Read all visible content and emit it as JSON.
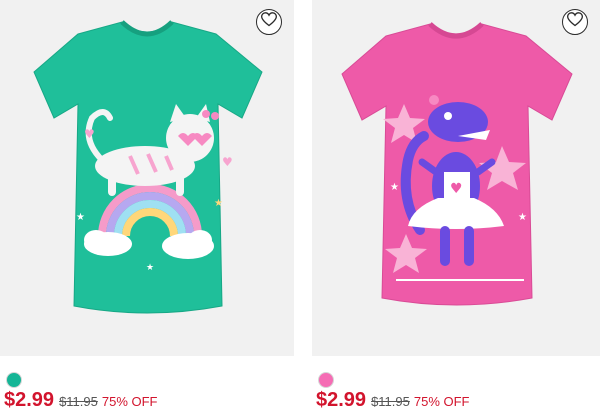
{
  "colors": {
    "price": "#d2142d",
    "panel": "#f1f1f1"
  },
  "products": [
    {
      "shirt_color": "#1fbf9a",
      "swatch_color": "#15b596",
      "price": "$2.99",
      "original_price": "$11.95",
      "discount": "75% OFF",
      "wishlist_icon": "heart-outline-icon"
    },
    {
      "shirt_color": "#ee5aa8",
      "swatch_color": "#f56cb4",
      "price": "$2.99",
      "original_price": "$11.95",
      "discount": "75% OFF",
      "wishlist_icon": "heart-outline-icon"
    }
  ]
}
